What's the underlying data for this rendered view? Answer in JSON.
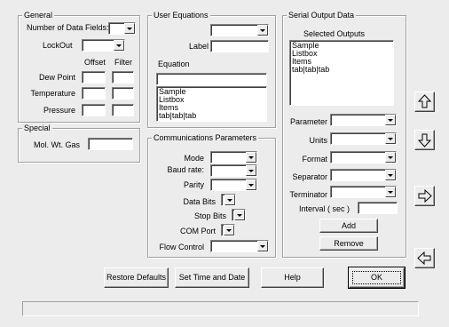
{
  "general": {
    "title": "General",
    "num_fields_label": "Number of Data Fields:",
    "lockout_label": "LockOut",
    "offset_label": "Offset",
    "filter_label": "Filter",
    "dew_point_label": "Dew Point",
    "temperature_label": "Temperature",
    "pressure_label": "Pressure"
  },
  "special": {
    "title": "Special",
    "mol_wt_label": "Mol. Wt. Gas"
  },
  "user_equations": {
    "title": "User Equations",
    "label_label": "Label",
    "equation_label": "Equation",
    "list_items": [
      "Sample",
      "Listbox",
      "Items",
      "tab|tab|tab"
    ]
  },
  "comms": {
    "title": "Communications Parameters",
    "mode_label": "Mode",
    "baud_label": "Baud rate:",
    "parity_label": "Parity",
    "data_bits_label": "Data Bits",
    "stop_bits_label": "Stop Bits",
    "com_port_label": "COM Port",
    "flow_control_label": "Flow Control"
  },
  "serial": {
    "title": "Serial Output Data",
    "selected_label": "Selected Outputs",
    "list_items": [
      "Sample",
      "Listbox",
      "Items",
      "tab|tab|tab"
    ],
    "parameter_label": "Parameter",
    "units_label": "Units",
    "format_label": "Format",
    "separator_label": "Separator",
    "terminator_label": "Terminator",
    "interval_label": "Interval ( sec )",
    "add_label": "Add",
    "remove_label": "Remove"
  },
  "buttons": {
    "restore_defaults": "Restore Defaults",
    "set_time": "Set Time and Date",
    "help": "Help",
    "ok": "OK"
  },
  "icons": {
    "up": "arrow-up-icon",
    "down": "arrow-down-icon",
    "right": "arrow-right-icon",
    "left": "arrow-left-icon"
  }
}
